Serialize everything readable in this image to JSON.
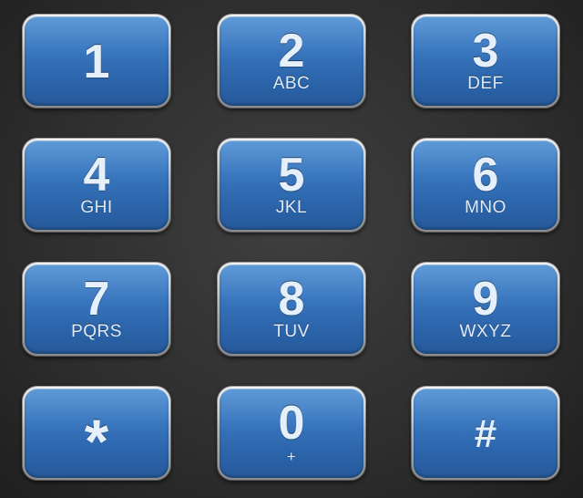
{
  "keypad": {
    "keys": [
      {
        "digit": "1",
        "letters": ""
      },
      {
        "digit": "2",
        "letters": "ABC"
      },
      {
        "digit": "3",
        "letters": "DEF"
      },
      {
        "digit": "4",
        "letters": "GHI"
      },
      {
        "digit": "5",
        "letters": "JKL"
      },
      {
        "digit": "6",
        "letters": "MNO"
      },
      {
        "digit": "7",
        "letters": "PQRS"
      },
      {
        "digit": "8",
        "letters": "TUV"
      },
      {
        "digit": "9",
        "letters": "WXYZ"
      },
      {
        "digit": "*",
        "letters": ""
      },
      {
        "digit": "0",
        "letters": "+"
      },
      {
        "digit": "#",
        "letters": ""
      }
    ]
  },
  "colors": {
    "key_blue": "#3a78c0",
    "key_rim": "#b9b9b9",
    "background": "#2e2e2e",
    "label": "#e6f0fa"
  }
}
